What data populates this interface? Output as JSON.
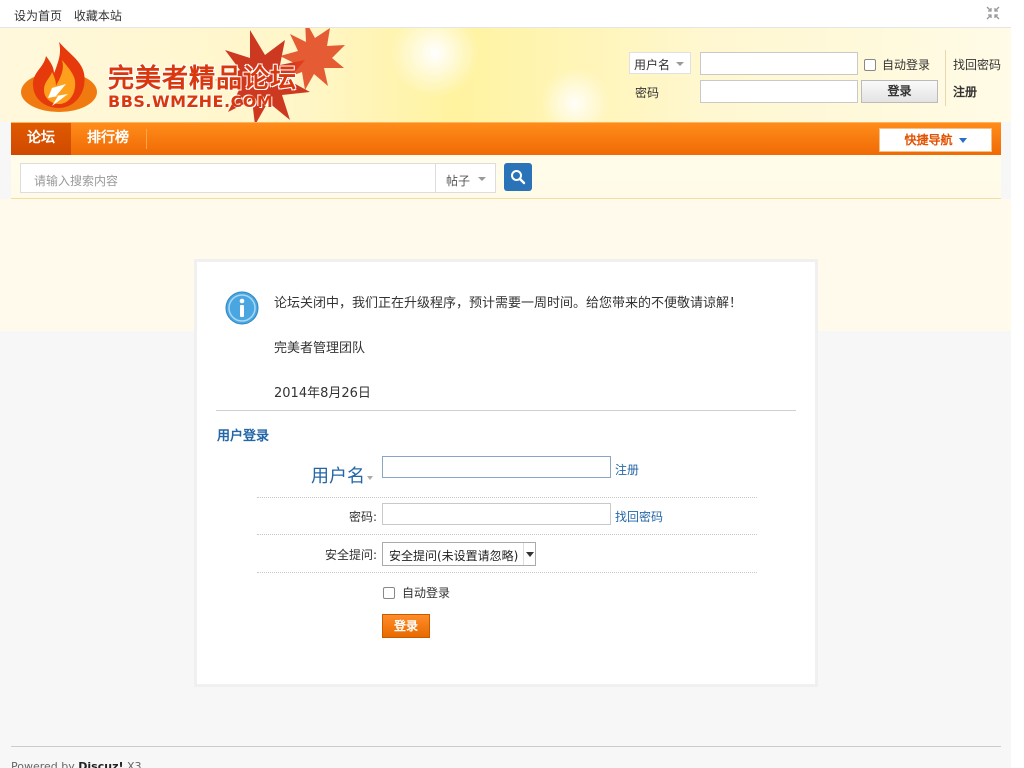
{
  "topbar": {
    "set_home": "设为首页",
    "bookmark": "收藏本站",
    "collapse_icon": "collapse-icon"
  },
  "header": {
    "logo_title": "完美者精品论坛",
    "logo_url": "BBS.WMZHE.COM"
  },
  "mini_login": {
    "user_type": "用户名",
    "password_label": "密码",
    "auto_login": "自动登录",
    "login_button": "登录",
    "forgot_password": "找回密码",
    "register": "注册"
  },
  "nav": {
    "tabs": [
      {
        "label": "论坛",
        "active": true
      },
      {
        "label": "排行榜",
        "active": false
      }
    ],
    "quick_nav": "快捷导航"
  },
  "search": {
    "placeholder": "请输入搜索内容",
    "type": "帖子"
  },
  "message": {
    "text": "论坛关闭中，我们正在升级程序，预计需要一周时间。给您带来的不便敬请谅解！",
    "team": "完美者管理团队",
    "date": "2014年8月26日"
  },
  "login_form": {
    "title": "用户登录",
    "username_label": "用户名",
    "register_link": "注册",
    "password_label": "密码:",
    "forgot_link": "找回密码",
    "security_label": "安全提问:",
    "security_value": "安全提问(未设置请忽略)",
    "auto_login": "自动登录",
    "submit": "登录"
  },
  "footer": {
    "powered_prefix": "Powered by ",
    "product": "Discuz!",
    "version": " X3"
  },
  "colors": {
    "nav_orange": "#f06a05",
    "link_blue": "#2366a8",
    "cream_bg": "#fffaec"
  }
}
